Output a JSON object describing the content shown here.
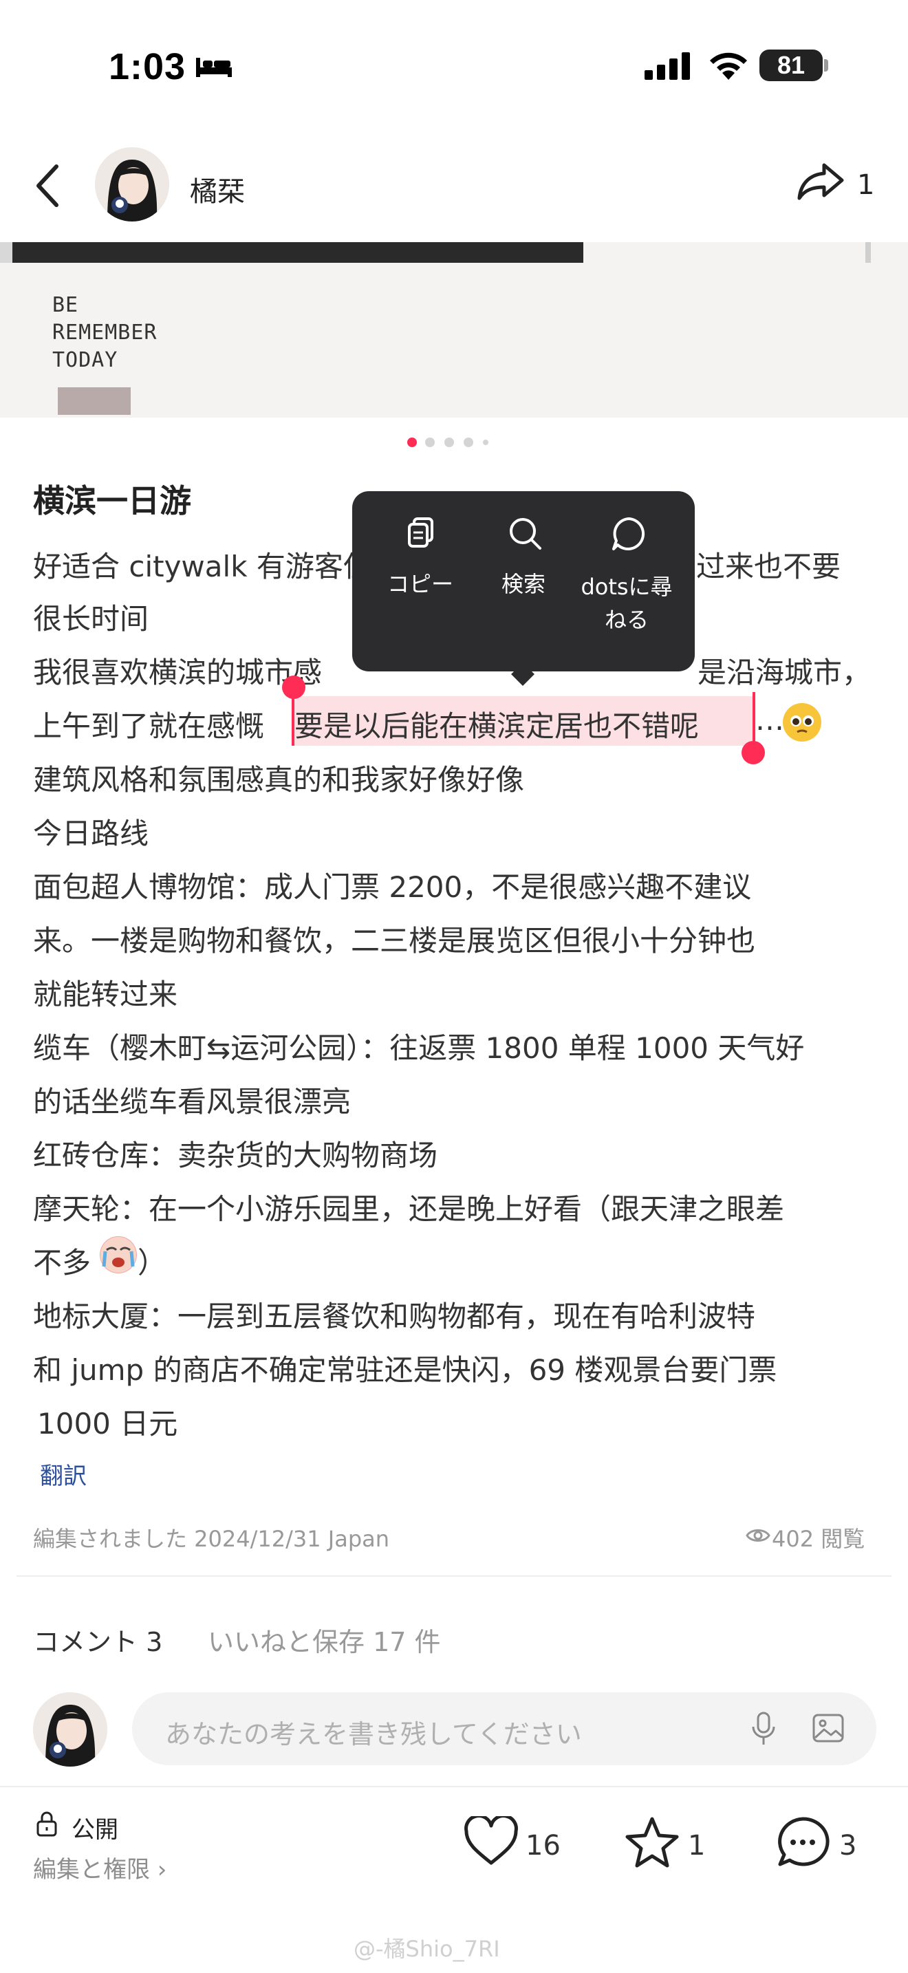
{
  "status_bar": {
    "time": "1:03",
    "battery": "81"
  },
  "header": {
    "author": "橘栞",
    "share_count": "1"
  },
  "photo": {
    "lines": [
      "BE",
      "REMEMBER",
      "TODAY"
    ]
  },
  "post": {
    "title": "横滨一日游",
    "lines": [
      "好适合 citywalk 有游客但",
      "过来也不要",
      "很长时间",
      "我很喜欢横滨的城市感",
      "是沿海城市，",
      "上午到了就在感慨",
      "要是以后能在横滨定居也不错呢",
      "…",
      "建筑风格和氛围感真的和我家好像好像",
      "今日路线",
      "面包超人博物馆：成人门票 2200，不是很感兴趣不建议",
      "来。一楼是购物和餐饮，二三楼是展览区但很小十分钟也",
      "就能转过来",
      "缆车（樱木町⇆运河公园）：往返票 1800 单程 1000 天气好",
      "的话坐缆车看风景很漂亮",
      "红砖仓库：卖杂货的大购物商场",
      "摩天轮：在一个小游乐园里，还是晚上好看（跟天津之眼差",
      "不多",
      "）",
      "地标大厦：一层到五层餐饮和购物都有，现在有哈利波特",
      "和 jump 的商店不确定常驻还是快闪，69 楼观景台要门票",
      "1000 日元"
    ],
    "translate": "翻訳",
    "edited": "編集されました 2024/12/31 Japan",
    "views": "402 閲覧"
  },
  "context_menu": {
    "copy": "コピー",
    "search": "検索",
    "ask_line1": "dotsに尋",
    "ask_line2": "ねる"
  },
  "tabs": {
    "comments": "コメント 3",
    "likes_saves": "いいねと保存 17 件"
  },
  "comment_input": {
    "placeholder": "あなたの考えを書き残してください"
  },
  "footer": {
    "visibility": "公開",
    "edit_permissions": "編集と権限 ›",
    "likes": "16",
    "stars": "1",
    "comments": "3"
  },
  "watermark": "@-橘Shio_7RI",
  "colors": {
    "accent": "#ff2d55",
    "selection": "#fde0e3",
    "menu_bg": "#2c2c2e",
    "link": "#2b4f9c"
  }
}
